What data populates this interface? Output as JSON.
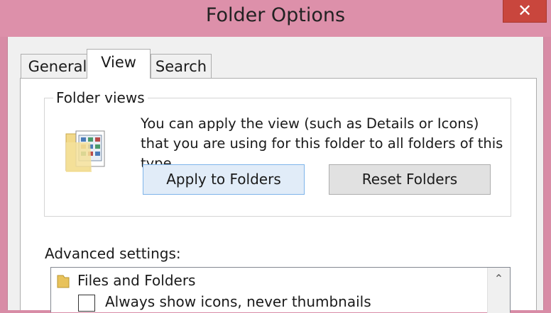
{
  "window": {
    "title": "Folder Options",
    "close_label": "✕"
  },
  "tabs": [
    {
      "label": "General",
      "active": false
    },
    {
      "label": "View",
      "active": true
    },
    {
      "label": "Search",
      "active": false
    }
  ],
  "folder_views": {
    "legend": "Folder views",
    "description": "You can apply the view (such as Details or Icons) that you are using for this folder to all folders of this type.",
    "icon": "folder-view-icon",
    "apply_button": "Apply to Folders",
    "reset_button": "Reset Folders"
  },
  "advanced": {
    "label": "Advanced settings:",
    "group_label": "Files and Folders",
    "group_icon": "folder-icon",
    "items": [
      {
        "label": "Always show icons, never thumbnails",
        "checked": false
      }
    ],
    "scroll_up_glyph": "⌃"
  },
  "colors": {
    "frame": "#d88ca6",
    "close_button": "#c9463d",
    "apply_button_bg": "#e1ecf8",
    "apply_button_border": "#7eb4ea"
  }
}
